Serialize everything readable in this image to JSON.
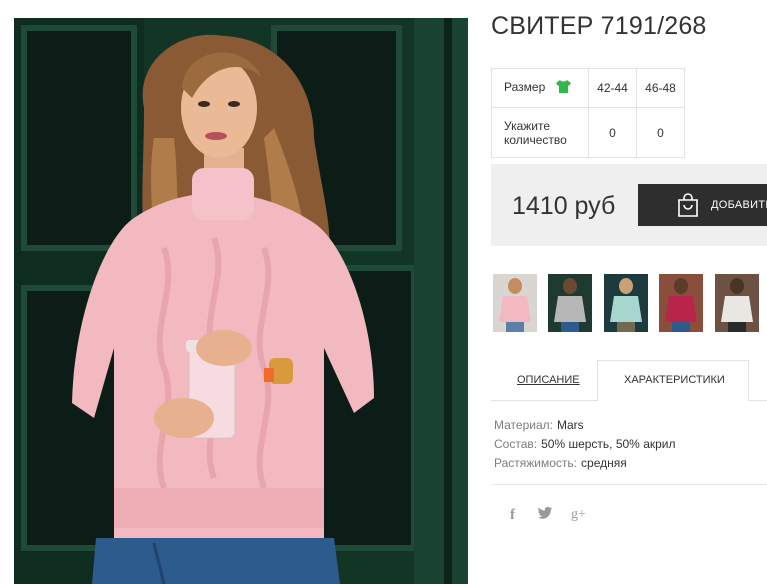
{
  "product": {
    "title": "СВИТЕР 7191/268",
    "price": "1410 руб",
    "add_to_cart_label": "ДОБАВИТЬ"
  },
  "sizes": {
    "size_label": "Размер",
    "quantity_label_line1": "Укажите",
    "quantity_label_line2": "количество",
    "columns": [
      {
        "size": "42-44",
        "quantity": "0"
      },
      {
        "size": "46-48",
        "quantity": "0"
      }
    ],
    "shirt_icon_color": "#2db84d"
  },
  "thumbnails": [
    {
      "name": "pink-sweater",
      "color": "#f2b9c0"
    },
    {
      "name": "grey-sweater",
      "color": "#b7b7b7"
    },
    {
      "name": "mint-sweater",
      "color": "#a7d6cf"
    },
    {
      "name": "red-sweater",
      "color": "#b8244a"
    },
    {
      "name": "white-sweater",
      "color": "#e9e7e3"
    }
  ],
  "tabs": {
    "description": "ОПИСАНИЕ",
    "characteristics": "ХАРАКТЕРИСТИКИ"
  },
  "properties": [
    {
      "key": "Материал:",
      "value": "Mars"
    },
    {
      "key": "Состав:",
      "value": "50% шерсть, 50% акрил"
    },
    {
      "key": "Растяжимость:",
      "value": "средняя"
    }
  ],
  "social": {
    "facebook": "f",
    "google_plus": "g+"
  },
  "colors": {
    "button_bg": "#2e2e2e",
    "price_bar_bg": "#efefef",
    "sweater": "#f2b9c0",
    "door_green": "#17402f"
  }
}
